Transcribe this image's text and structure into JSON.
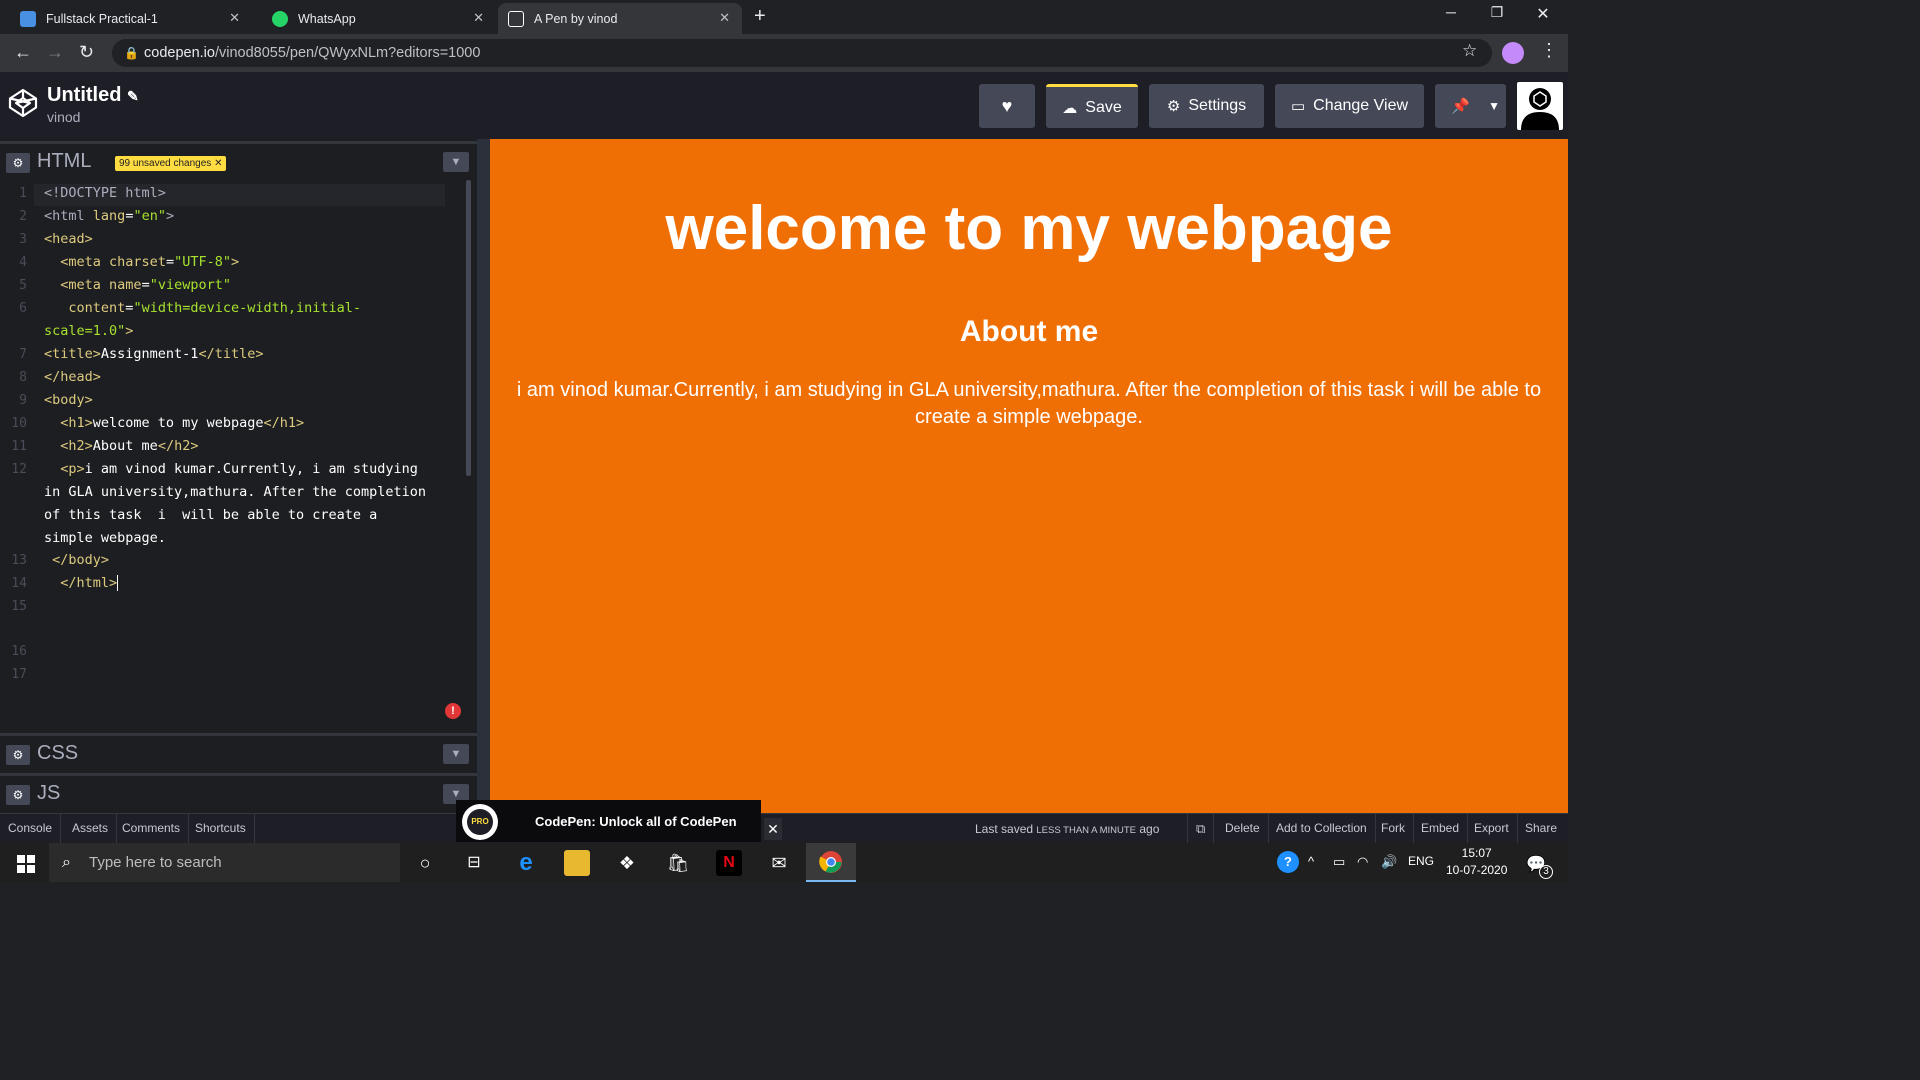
{
  "browser": {
    "tabs": [
      {
        "title": "Fullstack Practical-1",
        "icon_color": "#4a90e2"
      },
      {
        "title": "WhatsApp",
        "icon_color": "#25d366"
      },
      {
        "title": "A Pen by vinod",
        "icon_color": "#ffffff"
      }
    ],
    "url_host": "codepen.io",
    "url_path": "/vinod8055/pen/QWyxNLm?editors=1000"
  },
  "header": {
    "title": "Untitled",
    "author": "vinod",
    "save_label": "Save",
    "settings_label": "Settings",
    "change_view_label": "Change View"
  },
  "html_panel": {
    "label": "HTML",
    "unsaved_badge": "99 unsaved changes",
    "line_numbers": [
      "1",
      "2",
      "3",
      "4",
      "5",
      "6",
      "7",
      "8",
      "9",
      "10",
      "11",
      "12",
      "13",
      "14",
      "15",
      "16",
      "17"
    ]
  },
  "css_panel": {
    "label": "CSS"
  },
  "js_panel": {
    "label": "JS"
  },
  "preview": {
    "h1": "welcome to my webpage",
    "h2": "About me",
    "p": "i am vinod kumar.Currently, i am studying in GLA university,mathura. After the completion of this task i will be able to create a simple webpage."
  },
  "footer": {
    "left_buttons": [
      "Console",
      "Assets",
      "Comments",
      "Shortcuts"
    ],
    "last_saved": "Last saved",
    "last_saved_small": "LESS THAN A MINUTE",
    "last_saved_ago": "ago",
    "right_buttons": [
      "Delete",
      "Add to Collection",
      "Fork",
      "Embed",
      "Export",
      "Share"
    ]
  },
  "promo": {
    "badge": "PRO",
    "text": "CodePen: Unlock all of CodePen"
  },
  "taskbar": {
    "search_placeholder": "Type here to search",
    "language": "ENG",
    "time": "15:07",
    "date": "10-07-2020",
    "notifications": "3"
  },
  "colors": {
    "preview_bg": "#f06f05",
    "accent_yellow": "#ffdd40"
  }
}
